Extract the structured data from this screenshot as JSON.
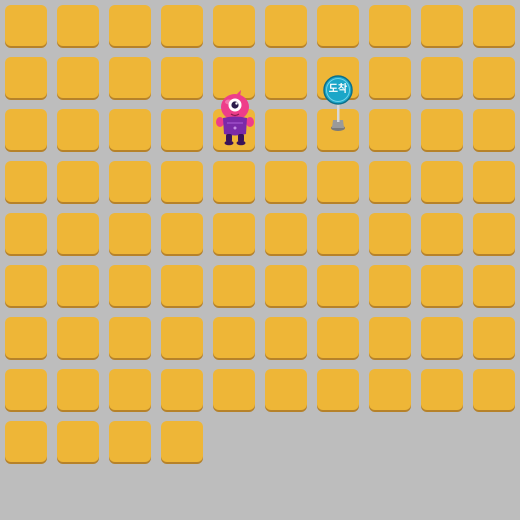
{
  "board": {
    "columns": 10,
    "rows": 9,
    "last_row_tile_count": 4,
    "tile_color": "#eeb637",
    "tile_shadow_color": "#b6822a",
    "background_color": "#bdbdbd"
  },
  "character": {
    "icon": "pink-one-eyed-monster-icon",
    "body_color": "#ee3d8a",
    "outfit_color": "#7b2aa8"
  },
  "goal": {
    "icon": "goal-sign-icon",
    "label": "도착",
    "sign_color": "#1ba6c8"
  }
}
